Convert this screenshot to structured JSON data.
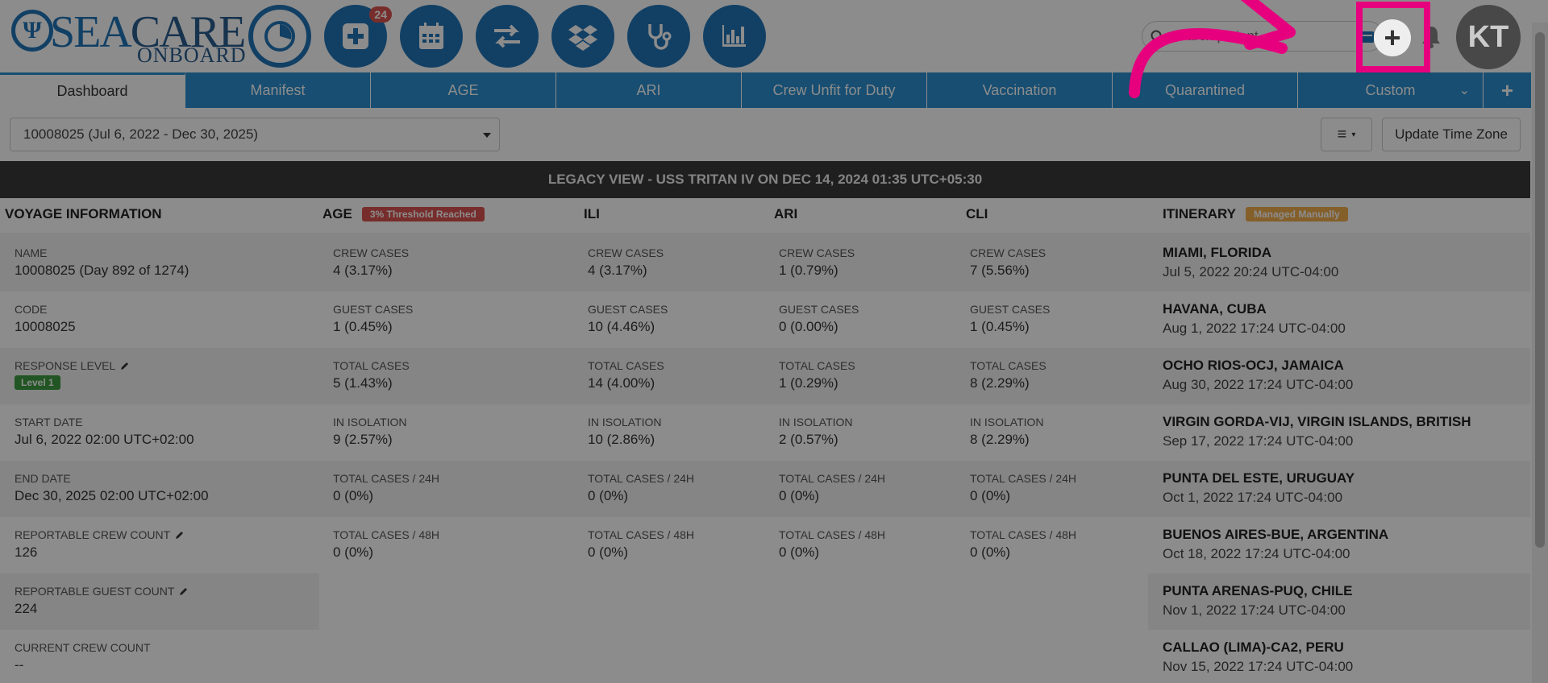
{
  "header": {
    "logo_sea": "SEA",
    "logo_care": "CARE",
    "logo_onboard": "ONBOARD",
    "notification_count": "24",
    "search_placeholder": "Search patient",
    "avatar_initials": "KT",
    "brand_color": "#2176b8",
    "highlight_color": "#e6007e"
  },
  "nav_icons": [
    "dashboard-icon",
    "add-patient-icon",
    "calendar-icon",
    "transfer-icon",
    "dropbox-icon",
    "stethoscope-icon",
    "bar-chart-icon"
  ],
  "tabs": [
    {
      "label": "Dashboard",
      "active": true
    },
    {
      "label": "Manifest"
    },
    {
      "label": "AGE"
    },
    {
      "label": "ARI"
    },
    {
      "label": "Crew Unfit for Duty"
    },
    {
      "label": "Vaccination"
    },
    {
      "label": "Quarantined"
    },
    {
      "label": "Custom"
    }
  ],
  "toolbar": {
    "voyage_select": "10008025 (Jul 6, 2022 - Dec 30, 2025)",
    "update_tz": "Update Time Zone"
  },
  "legacy_banner": "LEGACY VIEW - USS TRITAN IV ON DEC 14, 2024 01:35 UTC+05:30",
  "sections": {
    "voyage": "VOYAGE INFORMATION",
    "age": "AGE",
    "age_badge": "3% Threshold Reached",
    "ili": "ILI",
    "ari": "ARI",
    "cli": "CLI",
    "itinerary": "ITINERARY",
    "itinerary_badge": "Managed Manually"
  },
  "voyage": [
    {
      "label": "NAME",
      "value": "10008025 (Day 892 of 1274)"
    },
    {
      "label": "CODE",
      "value": "10008025"
    },
    {
      "label": "RESPONSE LEVEL",
      "value": "Level 1",
      "editable": true
    },
    {
      "label": "START DATE",
      "value": "Jul 6, 2022 02:00 UTC+02:00"
    },
    {
      "label": "END DATE",
      "value": "Dec 30, 2025 02:00 UTC+02:00"
    },
    {
      "label": "REPORTABLE CREW COUNT",
      "value": "126",
      "editable": true
    },
    {
      "label": "REPORTABLE GUEST COUNT",
      "value": "224",
      "editable": true
    },
    {
      "label": "CURRENT CREW COUNT",
      "value": "--"
    }
  ],
  "metric_labels": [
    "CREW CASES",
    "GUEST CASES",
    "TOTAL CASES",
    "IN ISOLATION",
    "TOTAL CASES / 24H",
    "TOTAL CASES / 48H"
  ],
  "age": [
    "4 (3.17%)",
    "1 (0.45%)",
    "5 (1.43%)",
    "9 (2.57%)",
    "0 (0%)",
    "0 (0%)"
  ],
  "ili": [
    "4 (3.17%)",
    "10 (4.46%)",
    "14 (4.00%)",
    "10 (2.86%)",
    "0 (0%)",
    "0 (0%)"
  ],
  "ari": [
    "1 (0.79%)",
    "0 (0.00%)",
    "1 (0.29%)",
    "2 (0.57%)",
    "0 (0%)",
    "0 (0%)"
  ],
  "cli": [
    "7 (5.56%)",
    "1 (0.45%)",
    "8 (2.29%)",
    "8 (2.29%)",
    "0 (0%)",
    "0 (0%)"
  ],
  "itinerary": [
    {
      "port": "MIAMI, FLORIDA",
      "date": "Jul 5, 2022 20:24 UTC-04:00"
    },
    {
      "port": "HAVANA, CUBA",
      "date": "Aug 1, 2022 17:24 UTC-04:00"
    },
    {
      "port": "OCHO RIOS-OCJ, JAMAICA",
      "date": "Aug 30, 2022 17:24 UTC-04:00"
    },
    {
      "port": "VIRGIN GORDA-VIJ, VIRGIN ISLANDS, BRITISH",
      "date": "Sep 17, 2022 17:24 UTC-04:00"
    },
    {
      "port": "PUNTA DEL ESTE, URUGUAY",
      "date": "Oct 1, 2022 17:24 UTC-04:00"
    },
    {
      "port": "BUENOS AIRES-BUE, ARGENTINA",
      "date": "Oct 18, 2022 17:24 UTC-04:00"
    },
    {
      "port": "PUNTA ARENAS-PUQ, CHILE",
      "date": "Nov 1, 2022 17:24 UTC-04:00"
    },
    {
      "port": "CALLAO (LIMA)-CA2, PERU",
      "date": "Nov 15, 2022 17:24 UTC-04:00"
    }
  ]
}
